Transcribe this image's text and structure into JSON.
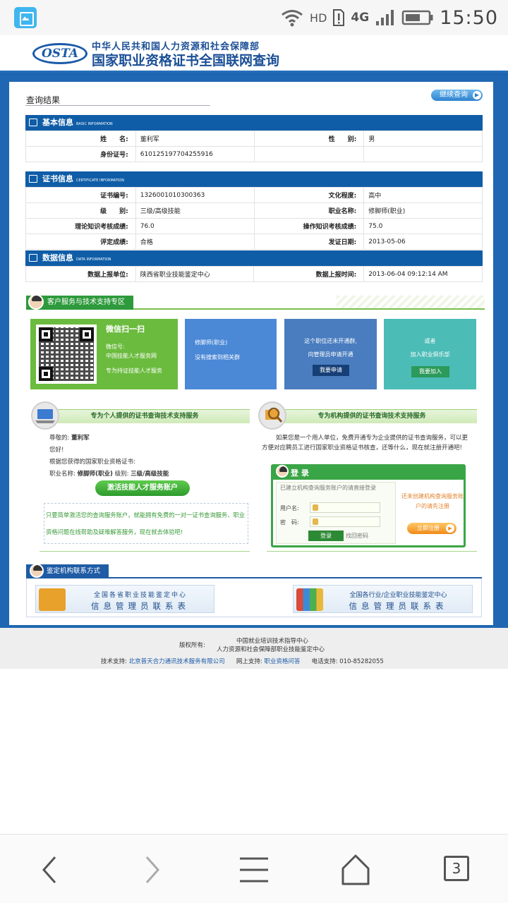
{
  "status_bar": {
    "hd": "HD",
    "network": "4G",
    "time": "15:50"
  },
  "header": {
    "logo": "OSTA",
    "subtitle": "中华人民共和国人力资源和社会保障部",
    "title": "国家职业资格证书全国联网查询"
  },
  "result": {
    "title": "查询结果",
    "continue_label": "继续查询"
  },
  "basic": {
    "title": "基本信息",
    "title_en": "BASIC INFORMATION",
    "rows": [
      {
        "k1": "姓　　名:",
        "v1": "董利军",
        "k2": "性　　别:",
        "v2": "男"
      },
      {
        "k1": "身份证号:",
        "v1": "610125197704255916",
        "k2": "",
        "v2": ""
      }
    ]
  },
  "cert": {
    "title": "证书信息",
    "title_en": "CERTIFICATE INFORMATION",
    "rows": [
      {
        "k1": "证书编号:",
        "v1": "1326001010300363",
        "k2": "文化程度:",
        "v2": "高中"
      },
      {
        "k1": "级　　别:",
        "v1": "三级/高级技能",
        "k2": "职业名称:",
        "v2": "修脚师(职业)"
      },
      {
        "k1": "理论知识考核成绩:",
        "v1": "76.0",
        "k2": "操作知识考核成绩:",
        "v2": "75.0"
      },
      {
        "k1": "评定成绩:",
        "v1": "合格",
        "k2": "发证日期:",
        "v2": "2013-05-06"
      }
    ]
  },
  "data_info": {
    "title": "数据信息",
    "title_en": "DATA INFORMATION",
    "rows": [
      {
        "k1": "数据上报单位:",
        "v1": "陕西省职业技能鉴定中心",
        "k2": "数据上报时间:",
        "v2": "2013-06-04 09:12:14 AM"
      }
    ]
  },
  "customer_service": {
    "title": "客户服务与技术支持专区"
  },
  "cards": {
    "wechat": {
      "title": "微信扫一扫",
      "line1": "微信号:",
      "line2": "中国技能人才服务网",
      "line3": "专为持证技能人才服务"
    },
    "group": {
      "line1": "修脚师(职业)",
      "line2": "没有搜索到相关群"
    },
    "apply": {
      "line1": "这个职位还未开通群,",
      "line2": "向管理员申请开通",
      "button": "我要申请"
    },
    "club": {
      "line1": "或者",
      "line2": "加入职业俱乐部",
      "button": "我要加入"
    }
  },
  "personal": {
    "header": "专为个人提供的证书查询技术支持服务",
    "greeting_label": "尊敬的:",
    "name": "董利军",
    "hello": "您好!",
    "obtained": "根据您获得的国家职业资格证书:",
    "occ_label": "职业名称:",
    "occ": "修脚师(职业)",
    "level_label": "级别:",
    "level": "三级/高级技能",
    "button": "激活技能人才服务账户",
    "promo": "只要简单激活您的查询服务账户，就能拥有免费的一对一证书查询服务、职业资格问题在线帮助及疑难解答服务，现在就去体验吧!"
  },
  "org": {
    "header": "专为机构提供的证书查询技术支持服务",
    "desc": "如果您是一个用人单位，免费开通专为企业提供的证书查询服务，可以更方便对应聘员工进行国家职业资格证书核查，还等什么，现在就注册开通吧!",
    "login_title": "登 录",
    "login_hint": "已建立机构查询服务账户的请直接登录",
    "user_label": "用户名:",
    "pass_label": "密　码:",
    "login_button": "登录",
    "forgot": "找回密码",
    "register_hint": "还未创建机构查询服务账户的请先注册",
    "register_button": "立即注册"
  },
  "appraisal": {
    "title": "鉴定机构联系方式",
    "item1_line1": "全国各省职业技能鉴定中心",
    "item1_line2": "信息管理员联系表",
    "item2_line1": "全国各行业/企业职业技能鉴定中心",
    "item2_line2": "信息管理员联系表"
  },
  "footer": {
    "copyright_label": "版权所有:",
    "org1": "中国就业培训技术指导中心",
    "org2": "人力资源和社会保障部职业技能鉴定中心",
    "tech_label": "技术支持:",
    "tech": "北京普天合力通讯技术服务有限公司",
    "online_label": "网上支持:",
    "online": "职业资格问答",
    "phone_label": "电话支持:",
    "phone": "010-85282055"
  },
  "navbar": {
    "tabs_count": "3"
  }
}
